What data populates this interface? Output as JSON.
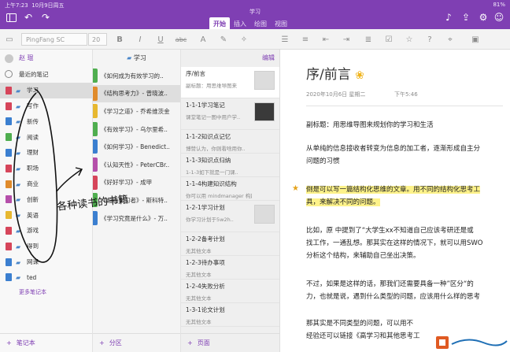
{
  "status": {
    "time": "上午7:23",
    "date": "10月9日周五",
    "battery": "81%"
  },
  "window": {
    "notebook_title": "学习",
    "tabs": [
      {
        "label": "开始",
        "active": true
      },
      {
        "label": "插入",
        "active": false
      },
      {
        "label": "绘图",
        "active": false
      },
      {
        "label": "视图",
        "active": false
      }
    ]
  },
  "toolbar": {
    "font_name": "PingFang SC",
    "font_size": "20",
    "bold": "B",
    "italic": "I",
    "underline": "U",
    "strikethrough": "abc"
  },
  "notebooks": {
    "user": "赵 琨",
    "recent": "最近的笔记",
    "items": [
      {
        "label": "学习",
        "color": "#d6455a",
        "selected": true
      },
      {
        "label": "写作",
        "color": "#d6455a"
      },
      {
        "label": "新传",
        "color": "#3b7fd0"
      },
      {
        "label": "阅读",
        "color": "#4fae4f"
      },
      {
        "label": "理财",
        "color": "#3b7fd0"
      },
      {
        "label": "职场",
        "color": "#d6455a"
      },
      {
        "label": "商业",
        "color": "#e08b2b"
      },
      {
        "label": "创新",
        "color": "#b54faa"
      },
      {
        "label": "英语",
        "color": "#e7b830"
      },
      {
        "label": "游戏",
        "color": "#d6455a"
      },
      {
        "label": "得到",
        "color": "#d6455a"
      },
      {
        "label": "网课",
        "color": "#3b7fd0"
      },
      {
        "label": "ted",
        "color": "#3b7fd0"
      }
    ],
    "more": "更多笔记本",
    "add_label": "笔记本"
  },
  "sections": {
    "title": "学习",
    "items": [
      {
        "label": "《如何成为有效学习的..",
        "color": "#4fae4f"
      },
      {
        "label": "《结构思考力》- 曾晓波..",
        "color": "#e08b2b",
        "selected": true
      },
      {
        "label": "《学习之道》- 乔希维茨金",
        "color": "#e7b830"
      },
      {
        "label": "《有效学习》- 乌尔里希..",
        "color": "#4fae4f"
      },
      {
        "label": "《如何学习》- Benedict..",
        "color": "#3b7fd0"
      },
      {
        "label": "《认知天性》- PeterCBr..",
        "color": "#b54faa"
      },
      {
        "label": "《好好学习》- 成甲",
        "color": "#d6455a"
      },
      {
        "label": "《超级学习者》- 斯科特..",
        "color": "#4fae4f"
      },
      {
        "label": "《学习究竟是什么》- 万..",
        "color": "#3b7fd0"
      }
    ],
    "add_label": "分区"
  },
  "pages": {
    "edit": "编辑",
    "items": [
      {
        "title": "序/前言",
        "sub": "副标题：用思维导图来",
        "thumb": "light",
        "selected": true
      },
      {
        "title": "1-1-1学习笔记",
        "sub": "课堂笔记一图中用户学..",
        "thumb": "dark"
      },
      {
        "title": "1-1-2知识点记忆",
        "sub": "博赞认为，你则看啥用你..",
        "thumb": ""
      },
      {
        "title": "1-1-3知识点归纳",
        "sub": "1-1-3如下就是一门课..",
        "thumb": ""
      },
      {
        "title": "1-1-4构建知识结构",
        "sub": "你可以用 mindmanager 构建自己的..",
        "thumb": ""
      },
      {
        "title": "1-2-1学习计划",
        "sub": "你学习计划于5w2h..",
        "thumb": "light"
      },
      {
        "title": "1-2-2备考计划",
        "sub": "无其他文本",
        "thumb": ""
      },
      {
        "title": "1-2-3待办事项",
        "sub": "无其他文本",
        "thumb": ""
      },
      {
        "title": "1-2-4失败分析",
        "sub": "无其他文本",
        "thumb": ""
      },
      {
        "title": "1-3-1论文计划",
        "sub": "无其他文本",
        "thumb": ""
      }
    ],
    "add_label": "页面"
  },
  "document": {
    "title": "序/前言",
    "date": "2020年10月6日  星期二",
    "time": "下午5:46",
    "paragraphs": [
      "副标题：用思维导图来规划你的学习和生活",
      "从单纯的信息接收者转变为信息的加工者，逐渐形成自主分",
      "问题的习惯",
      "倒是可以写一篇结构化思维的文章。用不同的结构化思考工",
      "具，来解决不同的问题。",
      "比如，原 中提到了“大学生xx不知道自己应该考研还是或",
      "找工作，一通乱想。那其实在这样的情况下，就可以用SWO",
      "分析这个结构，来辅助自己坐出决策。",
      "不过，如果是这样的话，那我们还需要具备一种”区分“的",
      "力，也就是说，遇到什么类型的问题，应该用什么样的思考",
      "那其实是不同类型的问题，可以用不",
      "经验还可以链接《高学习和其他思考工"
    ],
    "handwriting": "各种读书的书籍"
  }
}
